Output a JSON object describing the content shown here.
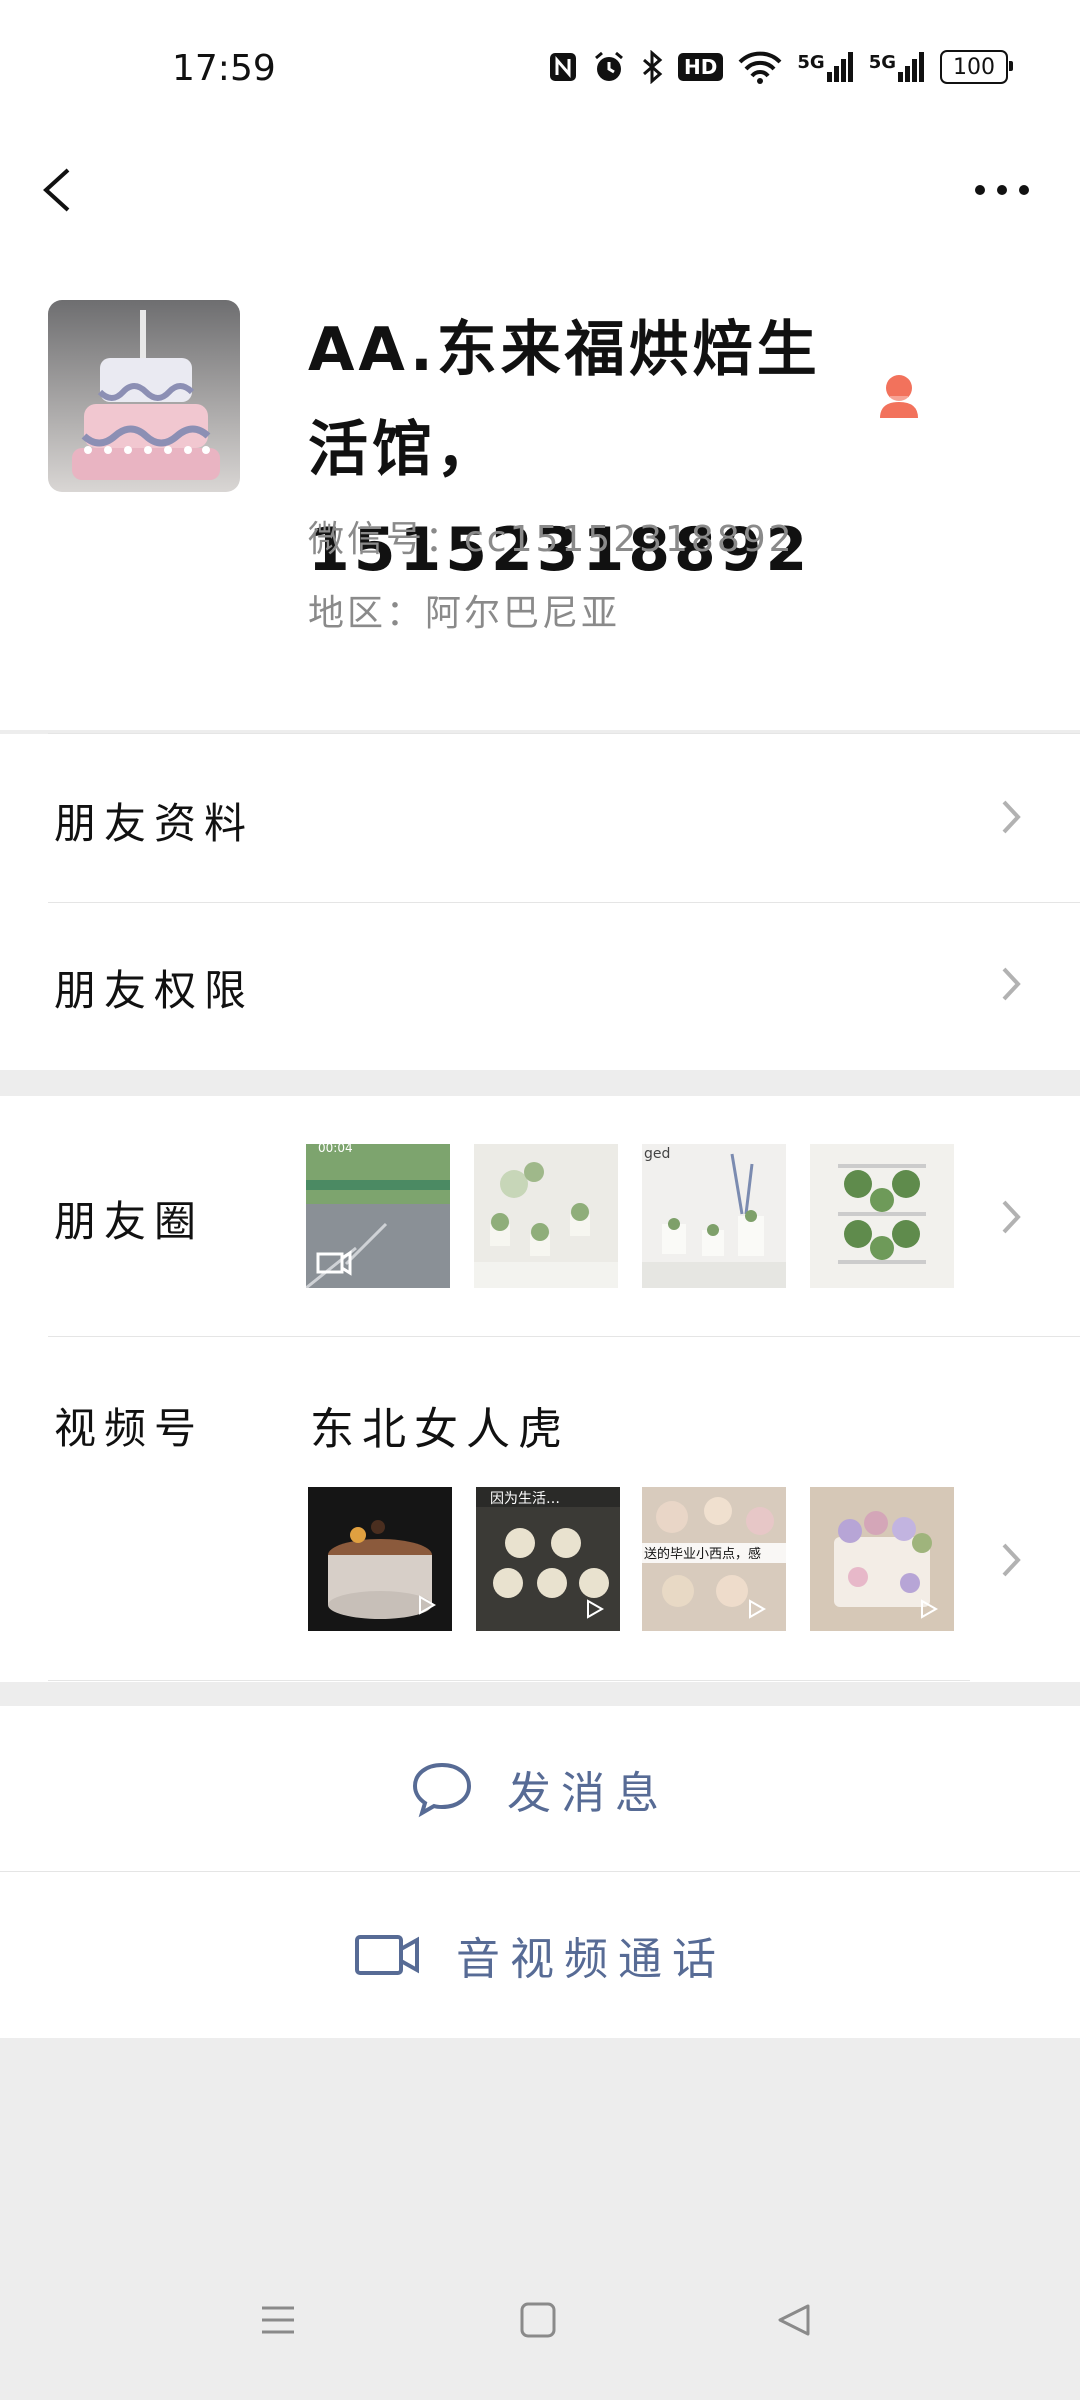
{
  "status_bar": {
    "time": "17:59",
    "battery": "100",
    "network_1": "5G",
    "network_2": "5G",
    "hd": "HD"
  },
  "profile": {
    "nickname": "AA.东来福烘焙生活馆，15152318892",
    "wechat_id": "微信号：cc15152318892",
    "region": "地区：阿尔巴尼亚"
  },
  "rows": {
    "friend_info": "朋友资料",
    "friend_permissions": "朋友权限",
    "moments": "朋友圈",
    "channels": "视频号",
    "channel_name": "东北女人虎"
  },
  "moments_thumbs": [
    {
      "label": "00:04",
      "kind": "video"
    },
    {
      "label": "",
      "kind": "photo"
    },
    {
      "label": "ged",
      "kind": "photo"
    },
    {
      "label": "",
      "kind": "photo"
    }
  ],
  "channel_thumbs": [
    {
      "label": "",
      "kind": "video"
    },
    {
      "label": "因为生活…",
      "kind": "video"
    },
    {
      "label": "送的毕业小西点，感",
      "kind": "video"
    },
    {
      "label": "",
      "kind": "video"
    }
  ],
  "actions": {
    "message": "发消息",
    "call": "音视频通话"
  },
  "colors": {
    "accent": "#576b95",
    "gender_female": "#f2725c",
    "background": "#ededed"
  }
}
